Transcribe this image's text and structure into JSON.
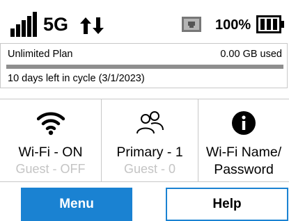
{
  "status": {
    "network_type": "5G",
    "battery_percent": "100%",
    "icons": [
      "signal-bars-icon",
      "data-arrows-icon",
      "ethernet-icon",
      "battery-icon"
    ]
  },
  "plan": {
    "name": "Unlimited Plan",
    "usage": "0.00 GB used",
    "usage_fraction": 1.0,
    "cycle_text": "10 days left in cycle (3/1/2023)"
  },
  "tiles": [
    {
      "icon": "wifi-icon",
      "main": "Wi-Fi - ON",
      "sub": "Guest - OFF"
    },
    {
      "icon": "users-icon",
      "main": "Primary - 1",
      "sub": "Guest - 0"
    },
    {
      "icon": "info-icon",
      "main": "Wi-Fi Name/",
      "sub": "Password"
    }
  ],
  "buttons": {
    "menu": "Menu",
    "help": "Help"
  },
  "colors": {
    "accent": "#1a82d2",
    "muted_text": "#c4c4c4",
    "usage_bar": "#8e8e8e"
  }
}
